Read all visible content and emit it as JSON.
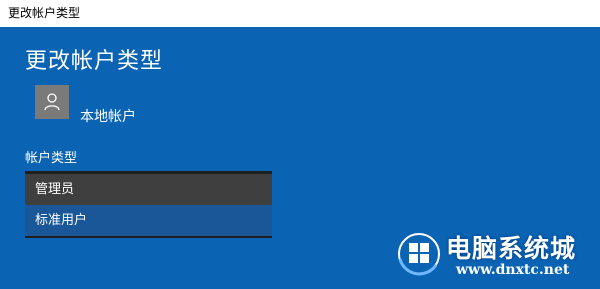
{
  "window": {
    "title": "更改帐户类型"
  },
  "page": {
    "heading": "更改帐户类型"
  },
  "account": {
    "name": "本地帐户",
    "avatar_icon": "user-icon"
  },
  "account_type": {
    "label": "帐户类型",
    "options": [
      "管理员",
      "标准用户"
    ],
    "selected": "标准用户"
  },
  "watermark": {
    "title": "电脑系统城",
    "url": "www.dnxtc.net"
  },
  "colors": {
    "background": "#0a63b3",
    "dropdown": "#1f1f1f",
    "selected": "#1a5799"
  }
}
